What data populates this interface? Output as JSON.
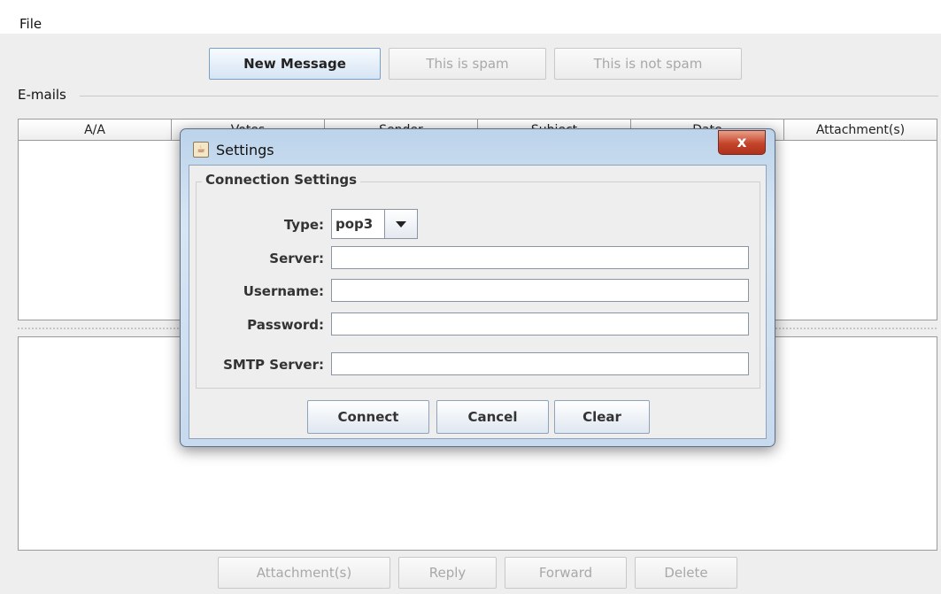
{
  "menu": {
    "file": "File"
  },
  "toolbar": {
    "new_message": "New Message",
    "this_is_spam": "This is spam",
    "this_is_not_spam": "This is not spam"
  },
  "emails_section": {
    "title": "E-mails"
  },
  "table": {
    "columns": [
      "A/A",
      "Votes",
      "Sender",
      "Subject",
      "Date",
      "Attachment(s)"
    ]
  },
  "bottom_toolbar": {
    "attachments": "Attachment(s)",
    "reply": "Reply",
    "forward": "Forward",
    "delete": "Delete"
  },
  "dialog": {
    "title": "Settings",
    "close_glyph": "x",
    "icon": "java-cup-icon",
    "group_title": "Connection Settings",
    "type_label": "Type:",
    "type_value": "pop3",
    "server_label": "Server:",
    "server_value": "",
    "username_label": "Username:",
    "username_value": "",
    "password_label": "Password:",
    "password_value": "",
    "smtp_label": "SMTP Server:",
    "smtp_value": "",
    "connect": "Connect",
    "cancel": "Cancel",
    "clear": "Clear"
  }
}
